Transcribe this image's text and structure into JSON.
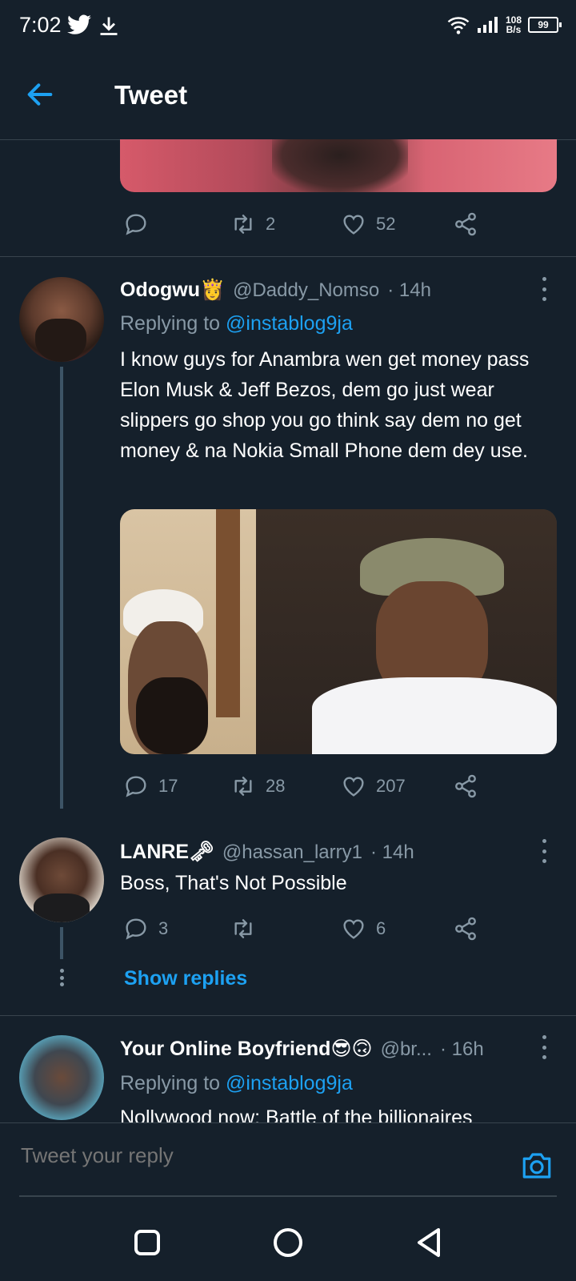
{
  "status_bar": {
    "time": "7:02",
    "net_speed_top": "108",
    "net_speed_bottom": "B/s",
    "battery": "99"
  },
  "header": {
    "title": "Tweet"
  },
  "prev_tweet": {
    "replies": "",
    "retweets": "2",
    "likes": "52"
  },
  "tweets": [
    {
      "display_name": "Odogwu👸",
      "handle": "@Daddy_Nomso",
      "time": "· 14h",
      "replying_prefix": "Replying to",
      "replying_to": "@instablog9ja",
      "text": "I know guys for Anambra wen get money pass Elon Musk & Jeff Bezos, dem go just wear slippers go shop you go think say dem no get money & na Nokia Small Phone dem dey use.",
      "replies": "17",
      "retweets": "28",
      "likes": "207"
    },
    {
      "display_name": "LANRE🗝",
      "handle": "@hassan_larry1",
      "time": "· 14h",
      "text": "Boss, That's Not Possible",
      "replies": "3",
      "retweets": "",
      "likes": "6",
      "show_replies": "Show replies"
    },
    {
      "display_name": "Your Online Boyfriend😎🙃",
      "handle": "@br...",
      "time": "· 16h",
      "replying_prefix": "Replying to",
      "replying_to": "@instablog9ja",
      "text": "Nollywood now: Battle of the billionaires"
    }
  ],
  "reply_bar": {
    "placeholder": "Tweet your reply"
  },
  "colors": {
    "background": "#15202b",
    "accent": "#1da1f2",
    "muted": "#8899a6",
    "divider": "#38444d"
  }
}
